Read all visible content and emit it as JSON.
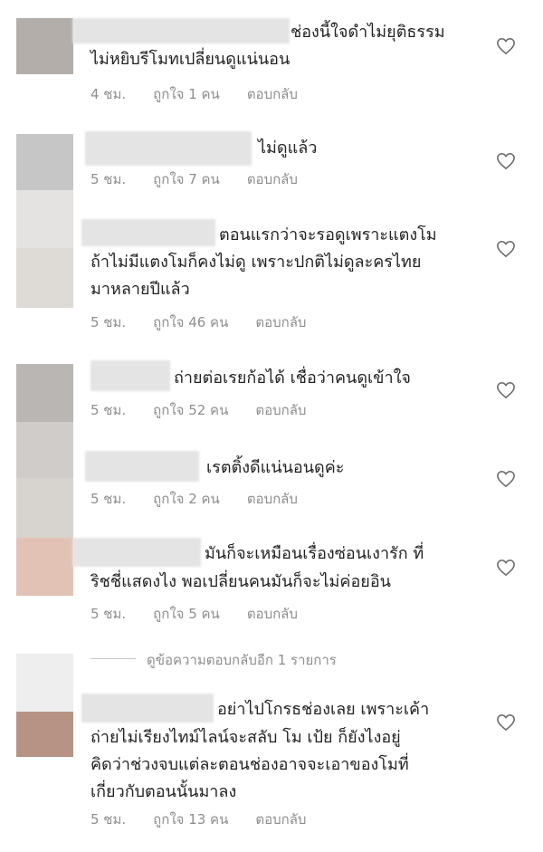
{
  "comments": [
    {
      "lines": [
        "ช่องนี้ใจดำไม่ยุติธรรม",
        "ไม่หยิบรีโมทเปลี่ยนดูแน่นอน"
      ],
      "time": "4 ชม.",
      "likes": "ถูกใจ 1 คน",
      "reply": "ตอบกลับ"
    },
    {
      "lines": [
        "ไม่ดูแล้ว"
      ],
      "time": "5 ชม.",
      "likes": "ถูกใจ 7 คน",
      "reply": "ตอบกลับ"
    },
    {
      "lines": [
        "ตอนแรกว่าจะรอดูเพราะแตงโม",
        "ถ้าไม่มีแตงโมก็คงไม่ดู เพราะปกติไม่ดูละครไทย",
        "มาหลายปีแล้ว"
      ],
      "time": "5 ชม.",
      "likes": "ถูกใจ 46 คน",
      "reply": "ตอบกลับ"
    },
    {
      "lines": [
        "ถ่ายต่อเรยก้อได้ เชื่อว่าคนดูเข้าใจ"
      ],
      "time": "5 ชม.",
      "likes": "ถูกใจ 52 คน",
      "reply": "ตอบกลับ"
    },
    {
      "lines": [
        "เรตติ้งดีแน่นอนดูค่ะ"
      ],
      "time": "5 ชม.",
      "likes": "ถูกใจ 2 คน",
      "reply": "ตอบกลับ"
    },
    {
      "lines": [
        "มันก็จะเหมือนเรื่องซ่อนเงารัก ที่",
        "ริชชี่แสดงไง พอเปลี่ยนคนมันก็จะไม่ค่อยอิน"
      ],
      "time": "5 ชม.",
      "likes": "ถูกใจ 5 คน",
      "reply": "ตอบกลับ"
    },
    {
      "lines": [
        "อย่าไปโกรธช่องเลย เพราะเค้า",
        "ถ่ายไม่เรียงไทม์ไลน์จะสลับ โม เป้ย ก็ยังไงอยู่",
        "คิดว่าช่วงจบแต่ละตอนช่องอาจจะเอาของโมที่",
        "เกี่ยวกับตอนนั้นมาลง"
      ],
      "time": "5 ชม.",
      "likes": "ถูกใจ 13 คน",
      "reply": "ตอบกลับ"
    }
  ],
  "view_more_replies": "ดูข้อความตอบกลับอีก 1 รายการ",
  "colors": {
    "avatar_strip": [
      "#b3aeaa",
      "#c4c4c4",
      "#dcdad6",
      "#b9b6b3",
      "#d4cfcb",
      "#e3c2b6",
      "#eeeeee",
      "#b79385"
    ]
  }
}
